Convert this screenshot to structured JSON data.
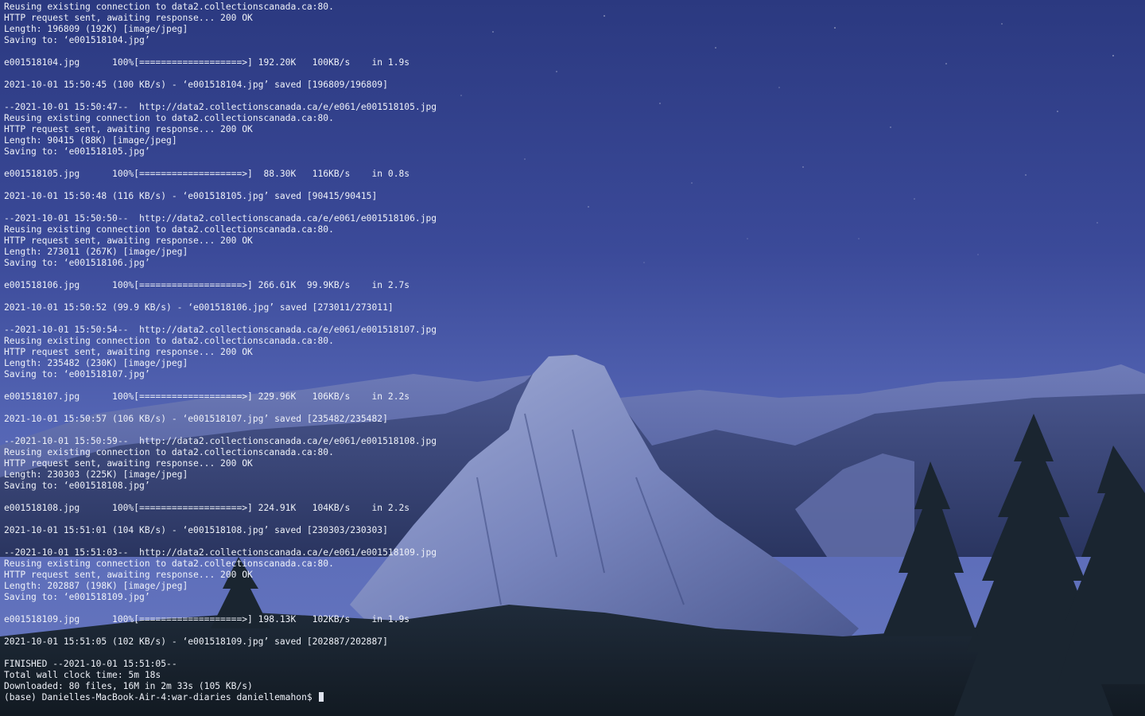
{
  "theme": {
    "text_color": "#eef1f8",
    "cursor_color": "#dfe3ee",
    "sky_top": "#2c3a82",
    "sky_bottom": "#5566b8",
    "mountain_color": "#6a76ad",
    "forest_color": "#1a2430"
  },
  "terminal": {
    "lines": [
      "Reusing existing connection to data2.collectionscanada.ca:80.",
      "HTTP request sent, awaiting response... 200 OK",
      "Length: 196809 (192K) [image/jpeg]",
      "Saving to: ‘e001518104.jpg’",
      "",
      "e001518104.jpg      100%[===================>] 192.20K   100KB/s    in 1.9s",
      "",
      "2021-10-01 15:50:45 (100 KB/s) - ‘e001518104.jpg’ saved [196809/196809]",
      "",
      "--2021-10-01 15:50:47--  http://data2.collectionscanada.ca/e/e061/e001518105.jpg",
      "Reusing existing connection to data2.collectionscanada.ca:80.",
      "HTTP request sent, awaiting response... 200 OK",
      "Length: 90415 (88K) [image/jpeg]",
      "Saving to: ‘e001518105.jpg’",
      "",
      "e001518105.jpg      100%[===================>]  88.30K   116KB/s    in 0.8s",
      "",
      "2021-10-01 15:50:48 (116 KB/s) - ‘e001518105.jpg’ saved [90415/90415]",
      "",
      "--2021-10-01 15:50:50--  http://data2.collectionscanada.ca/e/e061/e001518106.jpg",
      "Reusing existing connection to data2.collectionscanada.ca:80.",
      "HTTP request sent, awaiting response... 200 OK",
      "Length: 273011 (267K) [image/jpeg]",
      "Saving to: ‘e001518106.jpg’",
      "",
      "e001518106.jpg      100%[===================>] 266.61K  99.9KB/s    in 2.7s",
      "",
      "2021-10-01 15:50:52 (99.9 KB/s) - ‘e001518106.jpg’ saved [273011/273011]",
      "",
      "--2021-10-01 15:50:54--  http://data2.collectionscanada.ca/e/e061/e001518107.jpg",
      "Reusing existing connection to data2.collectionscanada.ca:80.",
      "HTTP request sent, awaiting response... 200 OK",
      "Length: 235482 (230K) [image/jpeg]",
      "Saving to: ‘e001518107.jpg’",
      "",
      "e001518107.jpg      100%[===================>] 229.96K   106KB/s    in 2.2s",
      "",
      "2021-10-01 15:50:57 (106 KB/s) - ‘e001518107.jpg’ saved [235482/235482]",
      "",
      "--2021-10-01 15:50:59--  http://data2.collectionscanada.ca/e/e061/e001518108.jpg",
      "Reusing existing connection to data2.collectionscanada.ca:80.",
      "HTTP request sent, awaiting response... 200 OK",
      "Length: 230303 (225K) [image/jpeg]",
      "Saving to: ‘e001518108.jpg’",
      "",
      "e001518108.jpg      100%[===================>] 224.91K   104KB/s    in 2.2s",
      "",
      "2021-10-01 15:51:01 (104 KB/s) - ‘e001518108.jpg’ saved [230303/230303]",
      "",
      "--2021-10-01 15:51:03--  http://data2.collectionscanada.ca/e/e061/e001518109.jpg",
      "Reusing existing connection to data2.collectionscanada.ca:80.",
      "HTTP request sent, awaiting response... 200 OK",
      "Length: 202887 (198K) [image/jpeg]",
      "Saving to: ‘e001518109.jpg’",
      "",
      "e001518109.jpg      100%[===================>] 198.13K   102KB/s    in 1.9s",
      "",
      "2021-10-01 15:51:05 (102 KB/s) - ‘e001518109.jpg’ saved [202887/202887]",
      "",
      "FINISHED --2021-10-01 15:51:05--",
      "Total wall clock time: 5m 18s",
      "Downloaded: 80 files, 16M in 2m 33s (105 KB/s)"
    ],
    "prompt": "(base) Danielles-MacBook-Air-4:war-diaries daniellemahon$ "
  }
}
